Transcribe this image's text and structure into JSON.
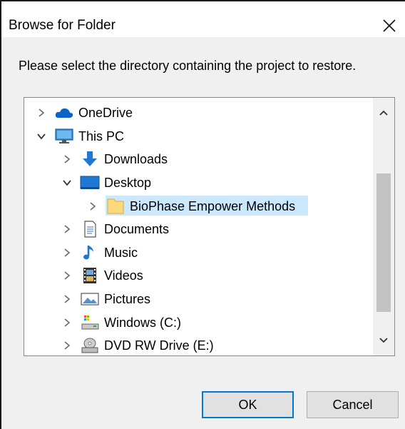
{
  "dialog": {
    "title": "Browse for Folder",
    "prompt": "Please select the directory containing the project to restore.",
    "ok_label": "OK",
    "cancel_label": "Cancel",
    "accent_color": "#0078d7",
    "selection_color": "#cce8ff"
  },
  "tree": {
    "items": [
      {
        "label": "OneDrive",
        "icon": "cloud-icon",
        "level": 0,
        "expanded": false
      },
      {
        "label": "This PC",
        "icon": "computer-icon",
        "level": 0,
        "expanded": true
      },
      {
        "label": "Downloads",
        "icon": "download-arrow-icon",
        "level": 1,
        "expanded": false
      },
      {
        "label": "Desktop",
        "icon": "desktop-icon",
        "level": 1,
        "expanded": true
      },
      {
        "label": "BioPhase Empower Methods",
        "icon": "folder-icon",
        "level": 2,
        "expanded": false,
        "selected": true
      },
      {
        "label": "Documents",
        "icon": "document-icon",
        "level": 1,
        "expanded": false
      },
      {
        "label": "Music",
        "icon": "music-note-icon",
        "level": 1,
        "expanded": false
      },
      {
        "label": "Videos",
        "icon": "film-icon",
        "level": 1,
        "expanded": false
      },
      {
        "label": "Pictures",
        "icon": "picture-icon",
        "level": 1,
        "expanded": false
      },
      {
        "label": "Windows (C:)",
        "icon": "hard-drive-icon",
        "level": 1,
        "expanded": false
      },
      {
        "label": "DVD RW Drive (E:)",
        "icon": "dvd-drive-icon",
        "level": 1,
        "expanded": false
      }
    ]
  }
}
